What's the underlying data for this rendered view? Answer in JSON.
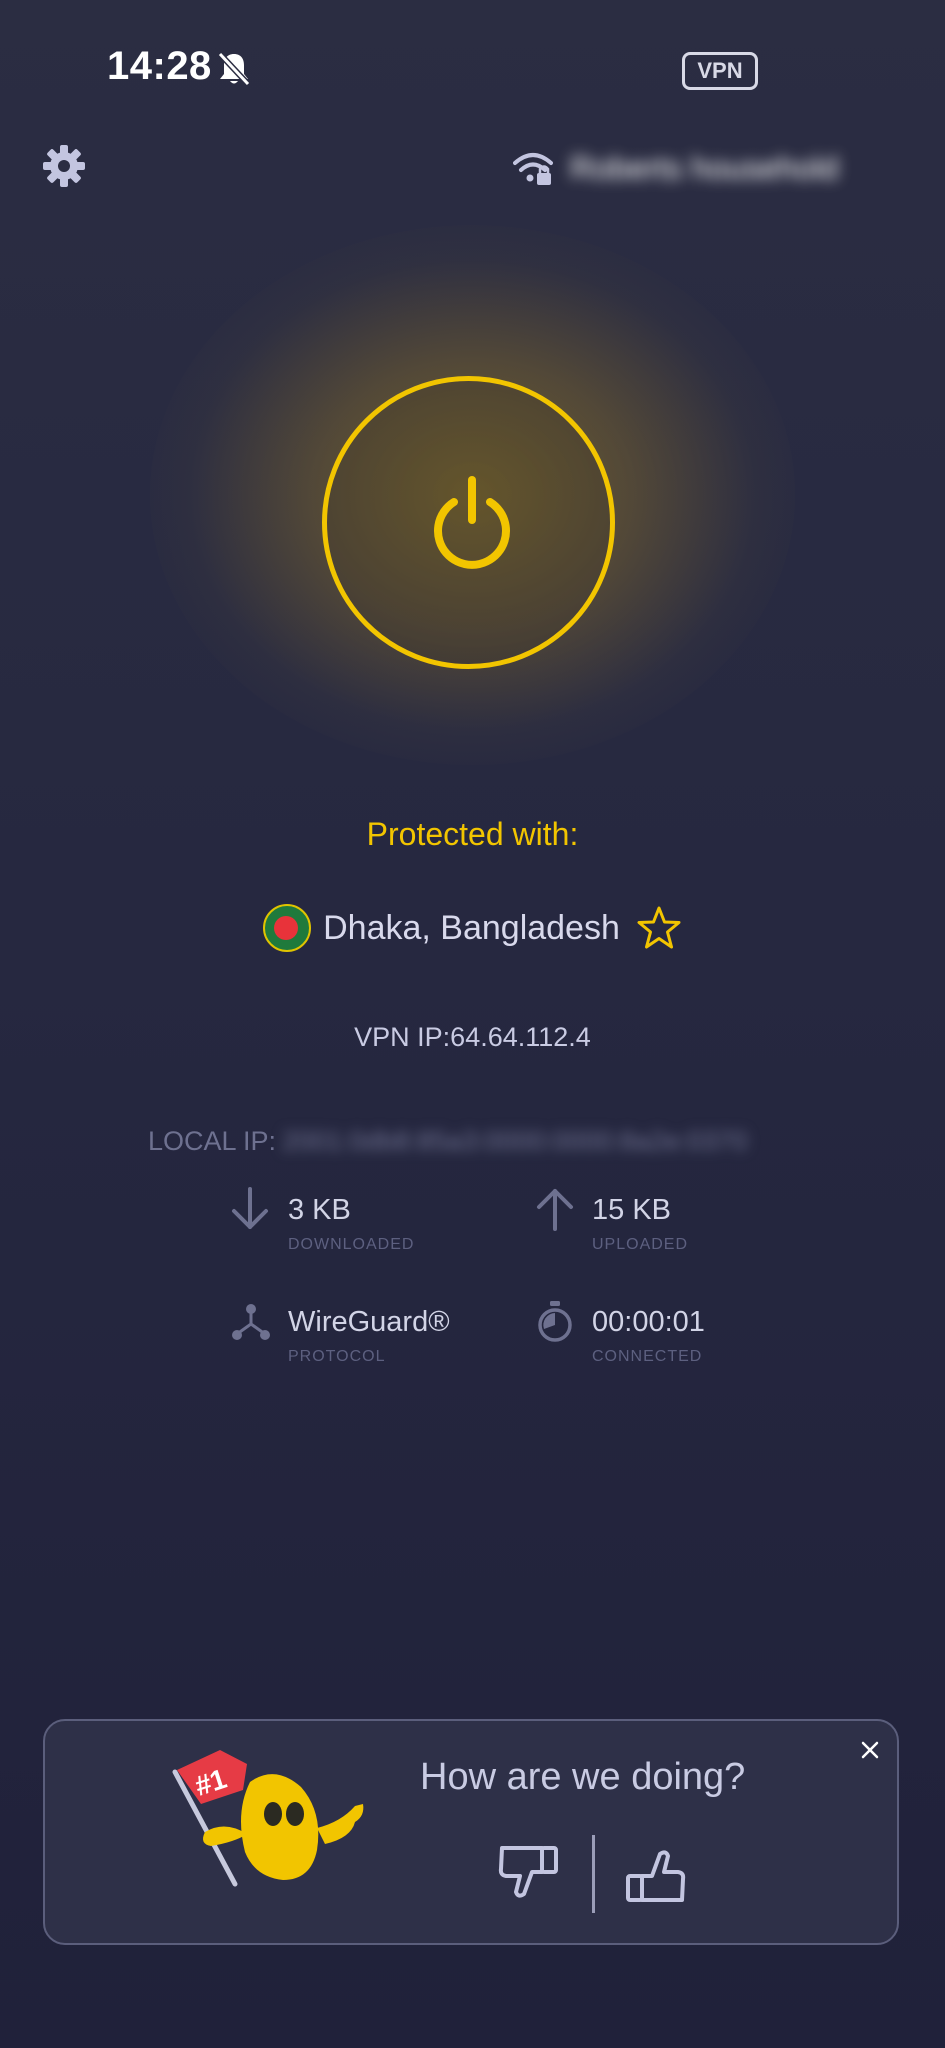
{
  "status_bar": {
    "time": "14:28",
    "vpn_badge": "VPN"
  },
  "header": {
    "network_name": "Roberts household"
  },
  "connection": {
    "protected_label": "Protected with:",
    "location": "Dhaka, Bangladesh",
    "vpn_ip": "VPN IP:64.64.112.4",
    "local_ip_label": "LOCAL IP:",
    "local_ip_value": "2001:0db8:85a3:0000:0000:8a2e:0370"
  },
  "stats": {
    "downloaded": {
      "value": "3 KB",
      "label": "DOWNLOADED"
    },
    "uploaded": {
      "value": "15 KB",
      "label": "UPLOADED"
    },
    "protocol": {
      "value": "WireGuard®",
      "label": "PROTOCOL"
    },
    "connected": {
      "value": "00:00:01",
      "label": "CONNECTED"
    }
  },
  "rating_card": {
    "title": "How are we doing?",
    "badge_text": "#1"
  },
  "colors": {
    "accent": "#f2c500",
    "background": "#262840",
    "text": "#c9cbe3"
  }
}
